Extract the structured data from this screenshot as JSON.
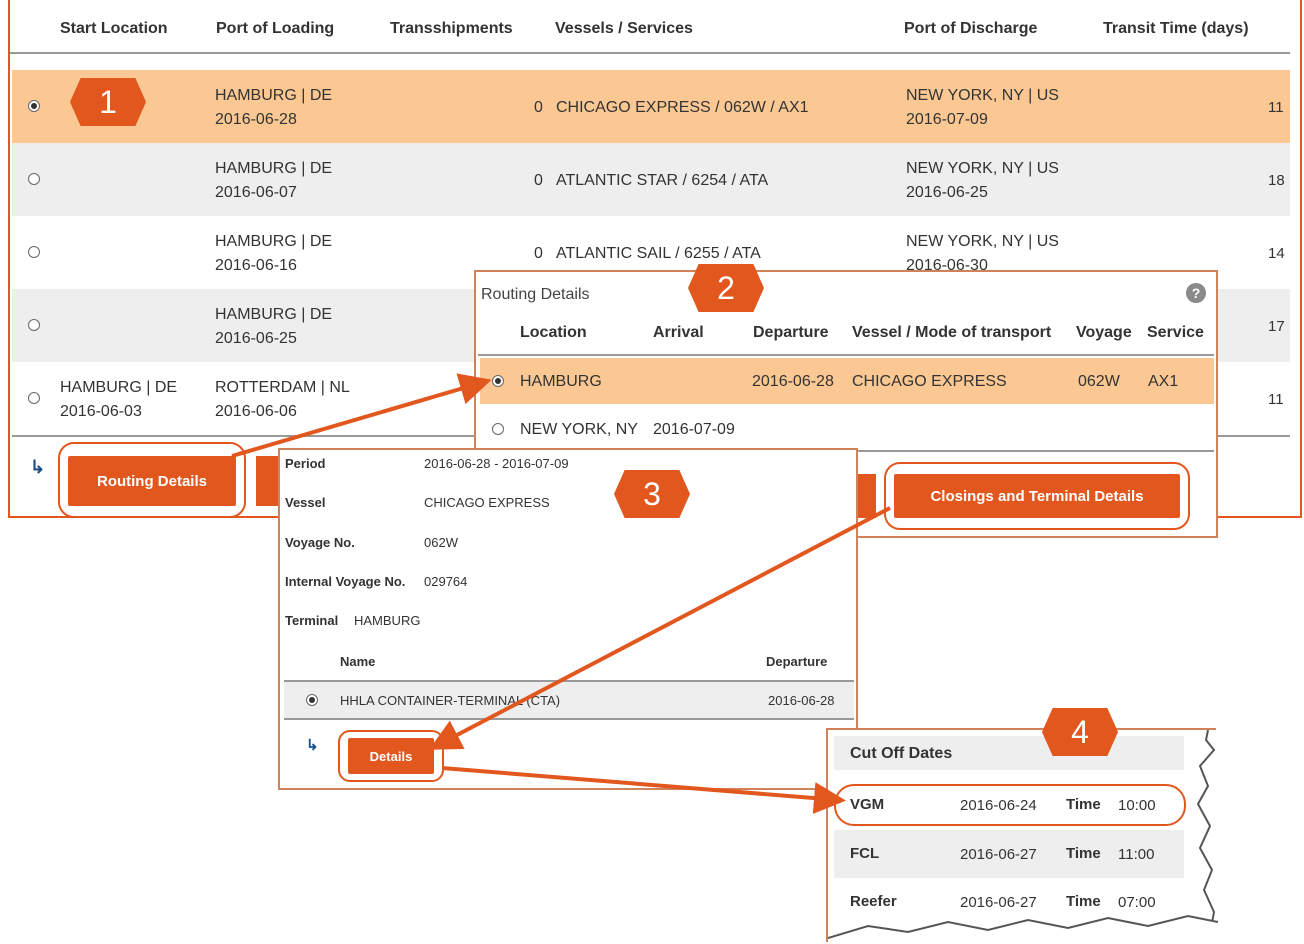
{
  "main_table": {
    "headers": [
      "Start Location",
      "Port of Loading",
      "Transshipments",
      "Vessels / Services",
      "Port of Discharge",
      "Transit Time (days)"
    ],
    "rows": [
      {
        "start": "",
        "start_date": "",
        "pol": "HAMBURG | DE",
        "pol_date": "2016-06-28",
        "trans": "0",
        "vessel": "CHICAGO EXPRESS / 062W / AX1",
        "pod": "NEW YORK, NY | US",
        "pod_date": "2016-07-09",
        "transit": "11",
        "selected": true
      },
      {
        "start": "",
        "start_date": "",
        "pol": "HAMBURG | DE",
        "pol_date": "2016-06-07",
        "trans": "0",
        "vessel": "ATLANTIC STAR / 6254 / ATA",
        "pod": "NEW YORK, NY | US",
        "pod_date": "2016-06-25",
        "transit": "18",
        "selected": false
      },
      {
        "start": "",
        "start_date": "",
        "pol": "HAMBURG | DE",
        "pol_date": "2016-06-16",
        "trans": "0",
        "vessel": "ATLANTIC SAIL / 6255 / ATA",
        "pod": "NEW YORK, NY | US",
        "pod_date": "2016-06-30",
        "transit": "14",
        "selected": false
      },
      {
        "start": "",
        "start_date": "",
        "pol": "HAMBURG | DE",
        "pol_date": "2016-06-25",
        "trans": "",
        "vessel": "",
        "pod": "",
        "pod_date": "",
        "transit": "17",
        "selected": false
      },
      {
        "start": "HAMBURG | DE",
        "start_date": "2016-06-03",
        "pol": "ROTTERDAM | NL",
        "pol_date": "2016-06-06",
        "trans": "",
        "vessel": "",
        "pod": "",
        "pod_date": "",
        "transit": "11",
        "selected": false
      }
    ],
    "routing_button": "Routing Details"
  },
  "routing_panel": {
    "title": "Routing Details",
    "headers": [
      "Location",
      "Arrival",
      "Departure",
      "Vessel / Mode of transport",
      "Voyage",
      "Service"
    ],
    "rows": [
      {
        "location": "HAMBURG",
        "arrival": "",
        "departure": "2016-06-28",
        "vessel": "CHICAGO EXPRESS",
        "voyage": "062W",
        "service": "AX1",
        "selected": true
      },
      {
        "location": "NEW YORK, NY",
        "arrival": "2016-07-09",
        "departure": "",
        "vessel": "",
        "voyage": "",
        "service": "",
        "selected": false
      }
    ],
    "closings_button": "Closings and Terminal Details",
    "help_icon": "?"
  },
  "terminal_panel": {
    "period_label": "Period",
    "period_value": "2016-06-28 - 2016-07-09",
    "vessel_label": "Vessel",
    "vessel_value": "CHICAGO EXPRESS",
    "voyage_label": "Voyage No.",
    "voyage_value": "062W",
    "internal_label": "Internal Voyage No.",
    "internal_value": "029764",
    "terminal_label": "Terminal",
    "terminal_value": "HAMBURG",
    "name_header": "Name",
    "departure_header": "Departure",
    "terminal_row_name": "HHLA CONTAINER-TERMINAL (CTA)",
    "terminal_row_date": "2016-06-28",
    "details_button": "Details"
  },
  "cutoff_panel": {
    "title": "Cut Off Dates",
    "rows": [
      {
        "label": "VGM",
        "date": "2016-06-24",
        "time_label": "Time",
        "time": "10:00"
      },
      {
        "label": "FCL",
        "date": "2016-06-27",
        "time_label": "Time",
        "time": "11:00"
      },
      {
        "label": "Reefer",
        "date": "2016-06-27",
        "time_label": "Time",
        "time": "07:00"
      }
    ]
  },
  "badges": [
    "1",
    "2",
    "3",
    "4"
  ],
  "colors": {
    "accent": "#e2571e",
    "selected_row": "#fbc893",
    "stripe": "#eeeeee"
  }
}
